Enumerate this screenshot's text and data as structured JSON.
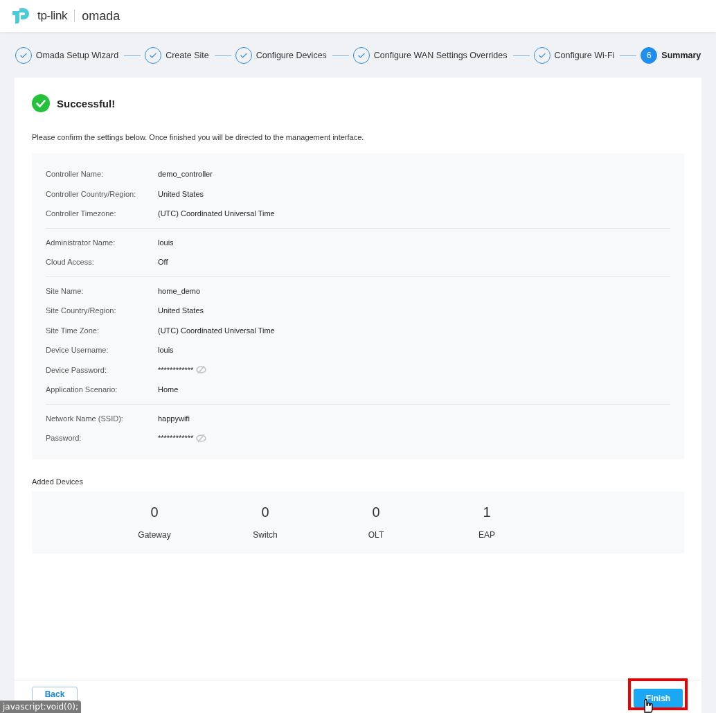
{
  "header": {
    "brand": "tp-link",
    "product": "omada"
  },
  "steps": [
    {
      "label": "Omada Setup Wizard",
      "completed": true
    },
    {
      "label": "Create Site",
      "completed": true
    },
    {
      "label": "Configure Devices",
      "completed": true
    },
    {
      "label": "Configure WAN Settings Overrides",
      "completed": true
    },
    {
      "label": "Configure Wi-Fi",
      "completed": true
    },
    {
      "label": "Summary",
      "completed": false,
      "number": "6"
    }
  ],
  "result": {
    "title": "Successful!",
    "message": "Please confirm the settings below. Once finished you will be directed to the management interface."
  },
  "settings_groups": [
    {
      "rows": [
        {
          "kind": "text",
          "label": "Controller Name:",
          "value": "demo_controller"
        },
        {
          "kind": "text",
          "label": "Controller Country/Region:",
          "value": "United States"
        },
        {
          "kind": "text",
          "label": "Controller Timezone:",
          "value": "(UTC) Coordinated Universal Time"
        }
      ]
    },
    {
      "rows": [
        {
          "kind": "text",
          "label": "Administrator Name:",
          "value": "louis"
        },
        {
          "kind": "text",
          "label": "Cloud Access:",
          "value": "Off"
        }
      ]
    },
    {
      "rows": [
        {
          "kind": "text",
          "label": "Site Name:",
          "value": "home_demo"
        },
        {
          "kind": "text",
          "label": "Site Country/Region:",
          "value": "United States"
        },
        {
          "kind": "text",
          "label": "Site Time Zone:",
          "value": "(UTC) Coordinated Universal Time"
        },
        {
          "kind": "text",
          "label": "Device Username:",
          "value": "louis"
        },
        {
          "kind": "password",
          "label": "Device Password:",
          "value": "************"
        },
        {
          "kind": "text",
          "label": "Application Scenario:",
          "value": "Home"
        }
      ]
    },
    {
      "rows": [
        {
          "kind": "text",
          "label": "Network Name (SSID):",
          "value": "happywifi"
        },
        {
          "kind": "password",
          "label": "Password:",
          "value": "************"
        }
      ]
    }
  ],
  "added_devices": {
    "title": "Added Devices",
    "items": [
      {
        "count": "0",
        "label": "Gateway"
      },
      {
        "count": "0",
        "label": "Switch"
      },
      {
        "count": "0",
        "label": "OLT"
      },
      {
        "count": "1",
        "label": "EAP"
      }
    ]
  },
  "footer": {
    "back": "Back",
    "finish": "Finish",
    "finish_highlighted": true
  },
  "status_tooltip": "javascript:void(0);"
}
